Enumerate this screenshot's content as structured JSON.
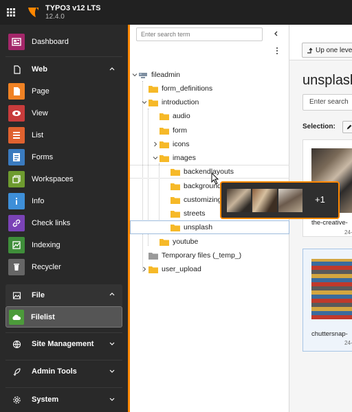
{
  "app": {
    "title": "TYPO3 v12 LTS",
    "version": "12.4.0"
  },
  "modulemenu": {
    "dashboard": "Dashboard",
    "web_group": "Web",
    "web_items": [
      "Page",
      "View",
      "List",
      "Forms",
      "Workspaces",
      "Info",
      "Check links",
      "Indexing",
      "Recycler"
    ],
    "file_group": "File",
    "file_items": [
      "Filelist"
    ],
    "site_group": "Site Management",
    "admin_group": "Admin Tools",
    "system_group": "System"
  },
  "tree": {
    "search_placeholder": "Enter search term",
    "root": "fileadmin",
    "nodes": [
      "form_definitions",
      "introduction",
      "audio",
      "form",
      "icons",
      "images",
      "backendlayouts",
      "background",
      "customizing",
      "streets",
      "unsplash",
      "youtube",
      "Temporary files (_temp_)",
      "user_upload"
    ]
  },
  "content": {
    "up_level": "Up one level",
    "title": "unsplash",
    "search_placeholder": "Enter search",
    "selection_label": "Selection:",
    "cards": [
      {
        "name": "the-creative-",
        "date": "24-"
      },
      {
        "name": "chuttersnap-",
        "date": "24-"
      }
    ]
  },
  "drag": {
    "count": "+1"
  },
  "colors": {
    "accent": "#ff8700",
    "menu_bg": "#292929",
    "topbar_bg": "#212121"
  }
}
